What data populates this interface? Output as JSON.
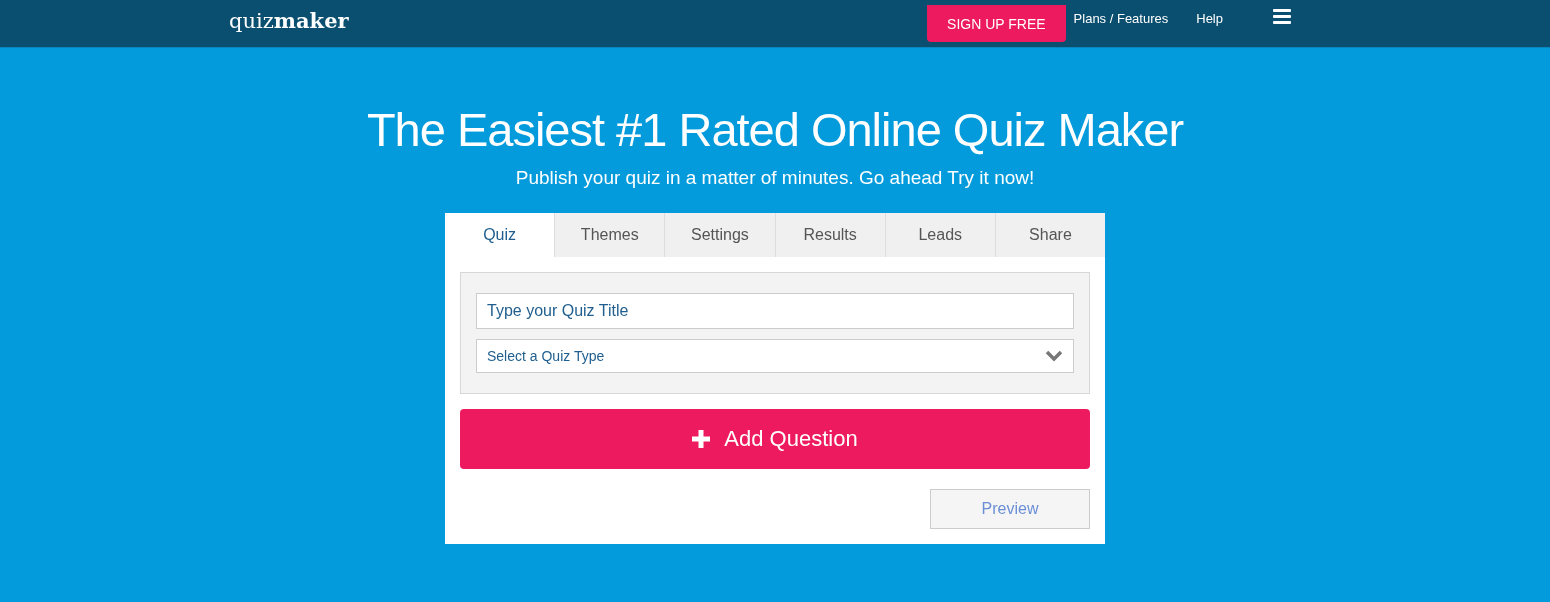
{
  "header": {
    "logo": "quiz**maker**",
    "signup_button": "SIGN UP FREE",
    "nav_links": [
      "Plans / Features",
      "Help"
    ]
  },
  "hero": {
    "title": "The Easiest #1 Rated Online Quiz Maker",
    "subtitle": "Publish your quiz in a matter of minutes. Go ahead Try it now!"
  },
  "tabs": [
    {
      "label": "Quiz",
      "selected": true
    },
    {
      "label": "Themes",
      "selected": false
    },
    {
      "label": "Settings",
      "selected": false
    },
    {
      "label": "Results",
      "selected": false
    },
    {
      "label": "Leads",
      "selected": false
    },
    {
      "label": "Share",
      "selected": false
    }
  ],
  "form": {
    "title_field": {
      "placeholder": "Type your Quiz Title"
    },
    "type_select": {
      "placeholder": "Select a Quiz Type"
    }
  },
  "add_button": "Add Question",
  "preview_button": "Preview"
}
